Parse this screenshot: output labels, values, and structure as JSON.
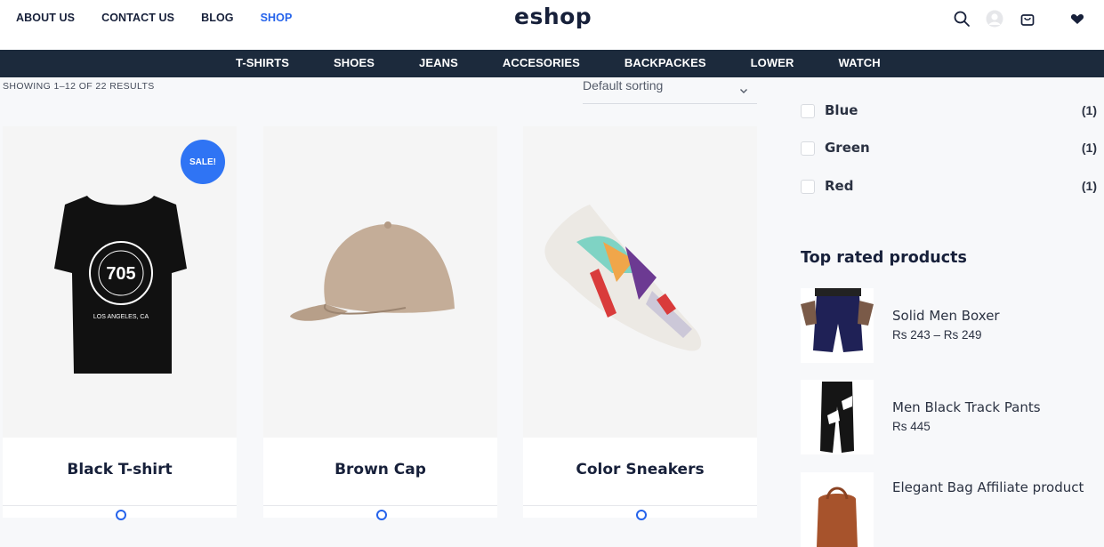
{
  "header": {
    "nav": [
      {
        "label": "ABOUT US",
        "active": false
      },
      {
        "label": "CONTACT US",
        "active": false
      },
      {
        "label": "BLOG",
        "active": false
      },
      {
        "label": "SHOP",
        "active": true
      }
    ],
    "logo": "eshop",
    "icons": [
      "search-icon",
      "user-avatar-icon",
      "cart-icon",
      "heart-icon"
    ]
  },
  "categories": [
    "T-SHIRTS",
    "SHOES",
    "JEANS",
    "ACCESORIES",
    "BACKPACKES",
    "LOWER",
    "WATCH"
  ],
  "listing": {
    "results_text": "SHOWING 1–12 OF 22 RESULTS",
    "sorting_value": "Default sorting"
  },
  "products": [
    {
      "title": "Black T-shirt",
      "badge": "SALE!"
    },
    {
      "title": "Brown Cap",
      "badge": ""
    },
    {
      "title": "Color Sneakers",
      "badge": ""
    }
  ],
  "sidebar": {
    "colors": [
      {
        "name": "Blue",
        "count": "(1)"
      },
      {
        "name": "Green",
        "count": "(1)"
      },
      {
        "name": "Red",
        "count": "(1)"
      }
    ],
    "top_rated_title": "Top rated products",
    "top_rated": [
      {
        "name": "Solid Men Boxer",
        "price": "Rs 243 – Rs 249"
      },
      {
        "name": "Men Black Track Pants",
        "price": "Rs 445"
      },
      {
        "name": "Elegant Bag Affiliate product",
        "price": ""
      }
    ]
  },
  "colors": {
    "accent": "#2563eb",
    "navbar": "#1c2a3c",
    "text": "#17203a"
  }
}
